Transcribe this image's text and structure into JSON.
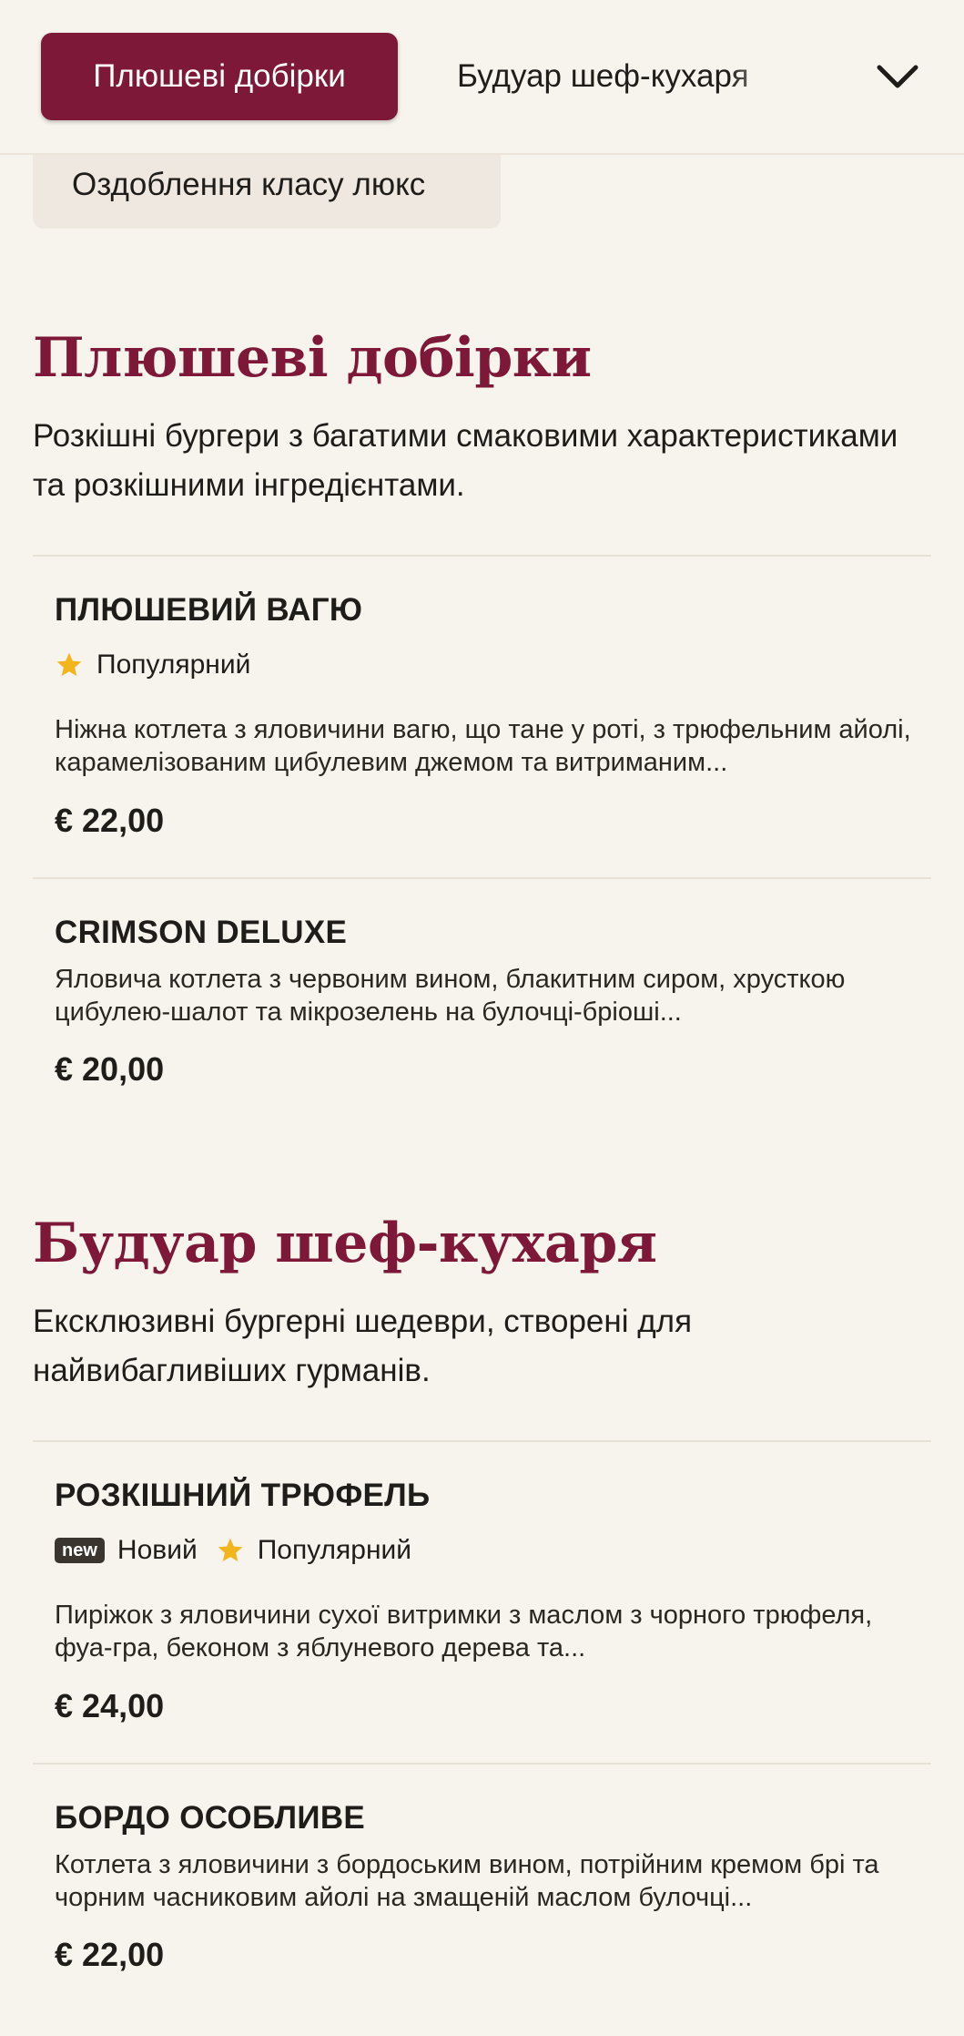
{
  "nav": {
    "active_tab": "Плюшеві добірки",
    "next_tab": "Будуар шеф-кухаря",
    "chip": "Оздоблення класу люкс"
  },
  "sections": [
    {
      "title": "Плюшеві добірки",
      "description": "Розкішні бургери з багатими смаковими характеристиками та розкішними інгредієнтами.",
      "items": [
        {
          "name": "ПЛЮШЕВИЙ ВАГЮ",
          "tag_popular": "Популярний",
          "description": "Ніжна котлета з яловичини вагю, що тане у роті, з трюфельним айолі, карамелізованим цибулевим джемом та витриманим...",
          "price": "€ 22,00"
        },
        {
          "name": "CRIMSON DELUXE",
          "description": "Яловича котлета з червоним вином, блакитним сиром, хрусткою цибулею-шалот та мікрозелень на булочці-бріоші...",
          "price": "€ 20,00"
        }
      ]
    },
    {
      "title": "Будуар шеф-кухаря",
      "description": "Ексклюзивні бургерні шедеври, створені для найвибагливіших гурманів.",
      "items": [
        {
          "name": "РОЗКІШНИЙ ТРЮФЕЛЬ",
          "badge_new": "new",
          "tag_new": "Новий",
          "tag_popular": "Популярний",
          "description": "Пиріжок з яловичини сухої витримки з маслом з чорного трюфеля, фуа-гра, беконом з яблуневого дерева та...",
          "price": "€ 24,00"
        },
        {
          "name": "БОРДО ОСОБЛИВЕ",
          "description": "Котлета з яловичини з бордоським вином, потрійним кремом брі та чорним часниковим айолі на змащеній маслом булочці...",
          "price": "€ 22,00"
        }
      ]
    }
  ],
  "colors": {
    "accent": "#7d1838",
    "background": "#f7f3ed",
    "star": "#f2b51d"
  },
  "icons": {
    "dropdown": "chevron-down-icon",
    "popular": "star-icon"
  }
}
